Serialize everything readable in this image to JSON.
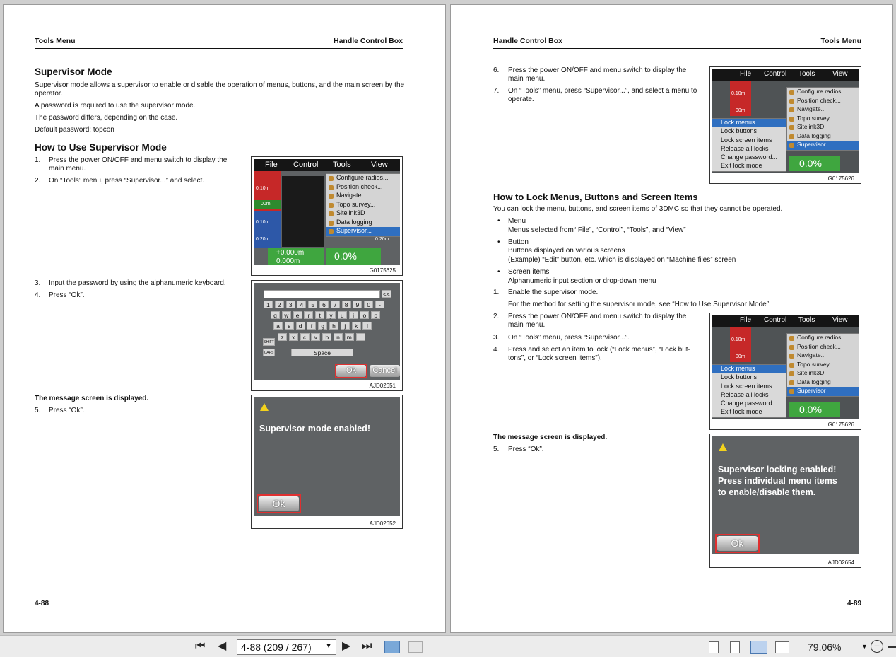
{
  "left": {
    "hdr_left": "Tools Menu",
    "hdr_right": "Handle Control Box",
    "title": "Supervisor Mode",
    "intro": "Supervisor mode allows a supervisor to enable or disable the operation of menus, buttons, and the main screen by the operator.",
    "p1": "A password is required to use the supervisor mode.",
    "p2": "The password differs, depending on the case.",
    "p3": "Default password: topcon",
    "subtitle": "How to Use Supervisor Mode",
    "steps": [
      {
        "n": "1.",
        "t": "Press the power ON/OFF and menu switch to display the main menu."
      },
      {
        "n": "2.",
        "t": "On “Tools” menu, press “Supervisor...” and select."
      },
      {
        "n": "3.",
        "t": "Input the password by using the alphanumeric keyboard."
      },
      {
        "n": "4.",
        "t": "Press “Ok”."
      },
      {
        "n": "5.",
        "t": "Press “Ok”."
      }
    ],
    "msg_caption": "The message screen is displayed.",
    "fig1": {
      "code": "G0175625",
      "menu": [
        "File",
        "Control",
        "Tools",
        "View"
      ],
      "items": [
        "Configure radios...",
        "Position check...",
        "Navigate...",
        "Topo survey...",
        "Sitelink3D",
        "Data logging",
        "Supervisor..."
      ],
      "d1": "0.10m",
      "d2": "00m",
      "d3": "0.10m",
      "d4": "0.20m",
      "d5": "0.20m",
      "v1": "+0.000m",
      "v2": "0.000m",
      "pct": "0.0%"
    },
    "fig2": {
      "code": "AJD02651",
      "back": "<<",
      "row1": [
        "1",
        "2",
        "3",
        "4",
        "5",
        "6",
        "7",
        "8",
        "9",
        "0",
        "-"
      ],
      "row2": [
        "q",
        "w",
        "e",
        "r",
        "t",
        "y",
        "u",
        "i",
        "o",
        "p"
      ],
      "row3": [
        "a",
        "s",
        "d",
        "f",
        "g",
        "h",
        "j",
        "k",
        "l"
      ],
      "row4": [
        "z",
        "x",
        "c",
        "v",
        "b",
        "n",
        "m",
        "."
      ],
      "shift": "SHIFT",
      "caps": "CAPS",
      "space": "Space",
      "ok": "Ok",
      "cancel": "Cancel"
    },
    "fig3": {
      "code": "AJD02652",
      "msg": "Supervisor mode enabled!",
      "ok": "Ok"
    },
    "page_no": "4-88"
  },
  "right": {
    "hdr_left": "Handle Control Box",
    "hdr_right": "Tools Menu",
    "steps_a": [
      {
        "n": "6.",
        "t": "Press the power ON/OFF and menu switch to display the main menu."
      },
      {
        "n": "7.",
        "t": "On “Tools” menu, press “Supervisor...”, and select a menu to operate."
      }
    ],
    "title": "How to Lock Menus, Buttons and Screen Items",
    "intro": "You can lock the menu, buttons, and screen items of 3DMC so that they cannot be operated.",
    "bullets": [
      {
        "h": "Menu",
        "t": "Menus selected from“ File”, “Control”, “Tools”, and “View”"
      },
      {
        "h": "Button",
        "t": "Buttons displayed on various screens",
        "t2": "(Example) “Edit” button, etc. which is displayed on “Machine files” screen"
      },
      {
        "h": "Screen items",
        "t": "Alphanumeric input section or drop-down menu"
      }
    ],
    "steps_b": [
      {
        "n": "1.",
        "t": "Enable the supervisor mode."
      },
      {
        "n": "",
        "t": "For the method for setting the supervisor mode, see “How to Use Supervisor Mode”."
      },
      {
        "n": "2.",
        "t": "Press the power ON/OFF and menu switch to display the main menu."
      },
      {
        "n": "3.",
        "t": "On “Tools” menu, press “Supervisor...”."
      },
      {
        "n": "4.",
        "t": "Press and select an item to lock (“Lock menus”, “Lock but-tons”, or “Lock screen items”)."
      },
      {
        "n": "5.",
        "t": "Press “Ok”."
      }
    ],
    "msg_caption": "The message screen is displayed.",
    "fig4": {
      "code": "G0175626",
      "menu": [
        "File",
        "Control",
        "Tools",
        "View"
      ],
      "items": [
        "Configure radios...",
        "Position check...",
        "Navigate...",
        "Topo survey...",
        "Sitelink3D",
        "Data logging",
        "Supervisor"
      ],
      "lock": [
        "Lock menus",
        "Lock buttons",
        "Lock screen items",
        "Release all locks",
        "Change password...",
        "Exit lock mode"
      ],
      "d1": "0.10m",
      "d2": "00m",
      "pct": "0.0%"
    },
    "fig5": {
      "code": "G0175626"
    },
    "fig6": {
      "code": "AJD02654",
      "msg": [
        "Supervisor locking enabled!",
        "Press individual menu items",
        "to enable/disable them."
      ],
      "ok": "Ok"
    },
    "page_no": "4-89"
  },
  "toolbar": {
    "page_field": "4-88 (209 / 267)",
    "zoom": "79.06%",
    "first": "⏮",
    "prev": "◀",
    "next": "▶",
    "last": "⏭"
  }
}
